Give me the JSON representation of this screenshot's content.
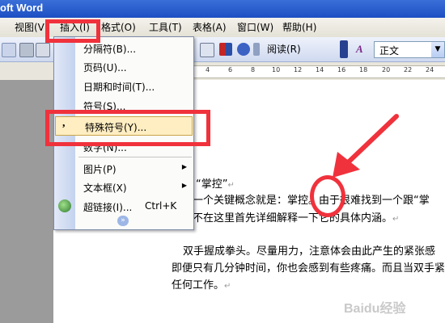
{
  "window": {
    "title": "oft Word"
  },
  "menubar": {
    "items": [
      "视图(V)",
      "插入(I)",
      "格式(O)",
      "工具(T)",
      "表格(A)",
      "窗口(W)",
      "帮助(H)"
    ]
  },
  "toolbar": {
    "read_label": "阅读(R)",
    "style_value": "正文"
  },
  "ruler": {
    "numbers": [
      "4",
      "6",
      "8",
      "10",
      "12",
      "14",
      "16",
      "18",
      "20",
      "22",
      "24"
    ]
  },
  "insert_menu": {
    "items": [
      {
        "label": "分隔符(B)...",
        "icon": ""
      },
      {
        "label": "页码(U)...",
        "icon": ""
      },
      {
        "label": "日期和时间(T)...",
        "icon": ""
      },
      {
        "label": "符号(S)...",
        "icon": ""
      },
      {
        "label": "特殊符号(Y)...",
        "icon": "comma-icon"
      },
      {
        "label": "数字(N)...",
        "icon": ""
      },
      {
        "label": "图片(P)",
        "icon": ""
      },
      {
        "label": "文本框(X)",
        "icon": ""
      },
      {
        "label": "超链接(I)...",
        "icon": "hyperlink-icon",
        "shortcut": "Ctrl+K"
      }
    ]
  },
  "document": {
    "line1": "“掌控”",
    "line2": "一个关键概念就是：掌控。由于很难找到一个跟“掌",
    "line3": "不在这里首先详细解释一下它的具体内涵。",
    "line4": "双手握成拳头。尽量用力，注意体会由此产生的紧张感",
    "line5": "即便只有几分钟时间，你也会感到有些疼痛。而且当双手紧",
    "line6": "任何工作。"
  },
  "colors": {
    "annotation_red": "#f0323c",
    "menu_highlight": "#ffeec2"
  },
  "watermark": "Baidu经验"
}
